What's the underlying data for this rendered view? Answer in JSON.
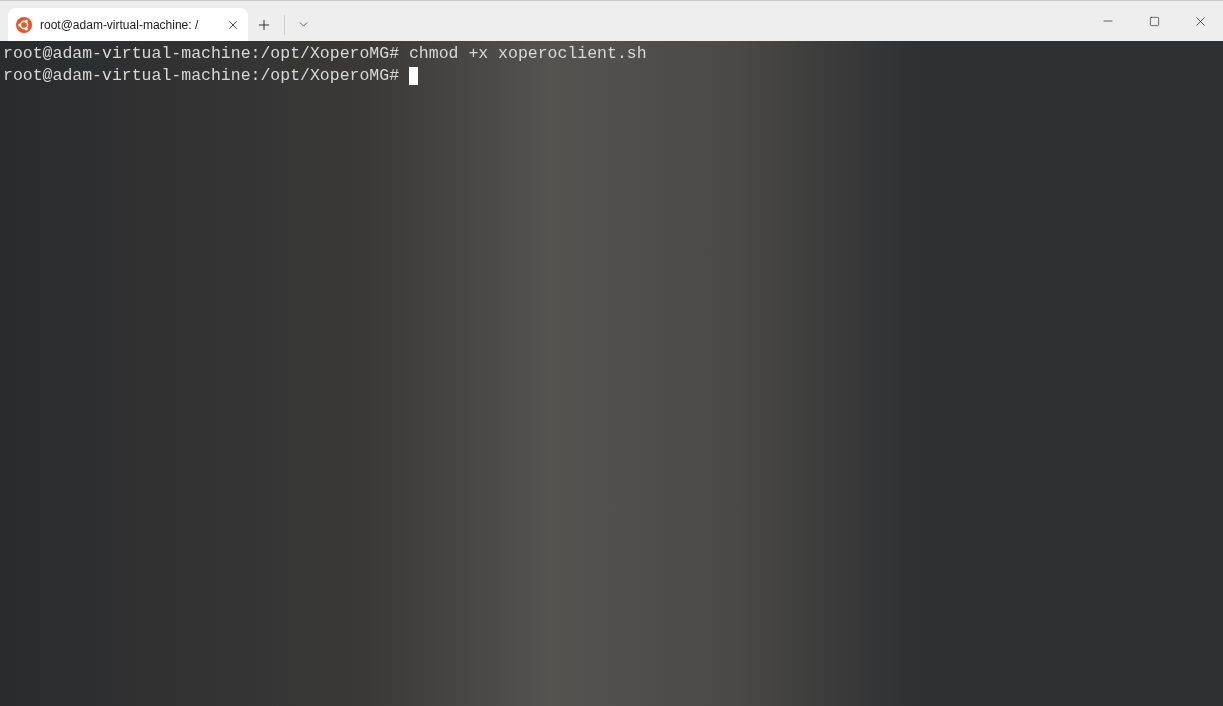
{
  "tabs": [
    {
      "title": "root@adam-virtual-machine: /",
      "selected": true
    }
  ],
  "terminal": {
    "lines": [
      {
        "text": "root@adam-virtual-machine:/opt/XoperoMG# chmod +x xoperoclient.sh",
        "cursor": false
      },
      {
        "text": "root@adam-virtual-machine:/opt/XoperoMG# ",
        "cursor": true
      }
    ]
  }
}
